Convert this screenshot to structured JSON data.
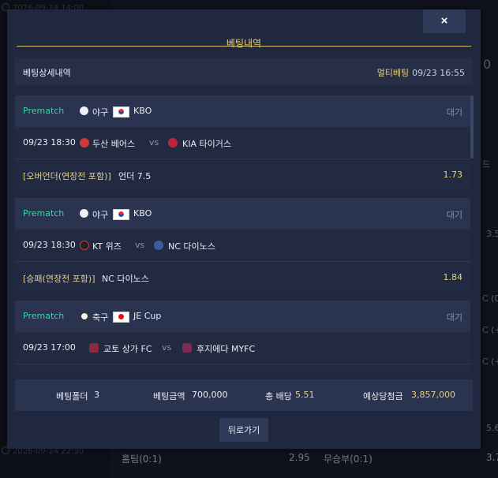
{
  "background": {
    "timestamps": [
      "2026-09-24 14:00",
      "2026-09-24 22:30"
    ],
    "right_fragments": [
      "0",
      "드",
      "3.5",
      "C (0)",
      "C (+0",
      "C (+1",
      "5.6"
    ],
    "bottom_row": {
      "label_1": "홈팀(0:1)",
      "odds_1": "2.95",
      "label_2": "무승부(0:1)",
      "odds_2": "3.7"
    }
  },
  "modal": {
    "close_label": "×",
    "title": "베팅내역",
    "detail_header": {
      "label": "베팅상세내역",
      "bet_type": "멀티베팅",
      "datetime": "09/23 16:55"
    },
    "bets": [
      {
        "prematch": "Prematch",
        "sport": "야구",
        "league": "KBO",
        "status": "대기",
        "time": "09/23 18:30",
        "home": "두산 베어스",
        "vs": "vs",
        "away": "KIA 타이거스",
        "market": "[오버언더(연장전 포함)]",
        "pick": "언더 7.5",
        "odds": "1.73"
      },
      {
        "prematch": "Prematch",
        "sport": "야구",
        "league": "KBO",
        "status": "대기",
        "time": "09/23 18:30",
        "home": "KT 위즈",
        "vs": "vs",
        "away": "NC 다이노스",
        "market": "[승패(연장전 포함)]",
        "pick": "NC 다이노스",
        "odds": "1.84"
      },
      {
        "prematch": "Prematch",
        "sport": "축구",
        "league": "JE Cup",
        "status": "대기",
        "time": "09/23 17:00",
        "home": "교토 상가 FC",
        "vs": "vs",
        "away": "후지에다 MYFC",
        "market": "",
        "pick": "",
        "odds": ""
      }
    ],
    "summary": {
      "folder_label": "베팅폴더",
      "folder_count": "3",
      "amount_label": "베팅금액",
      "amount": "700,000",
      "total_odds_label": "총 배당",
      "total_odds": "5.51",
      "expected_label": "예상당첨금",
      "expected": "3,857,000"
    },
    "back_label": "뒤로가기"
  },
  "colors": {
    "accent": "#e6cf7c",
    "prematch": "#39d4a3",
    "panel": "#202840"
  }
}
